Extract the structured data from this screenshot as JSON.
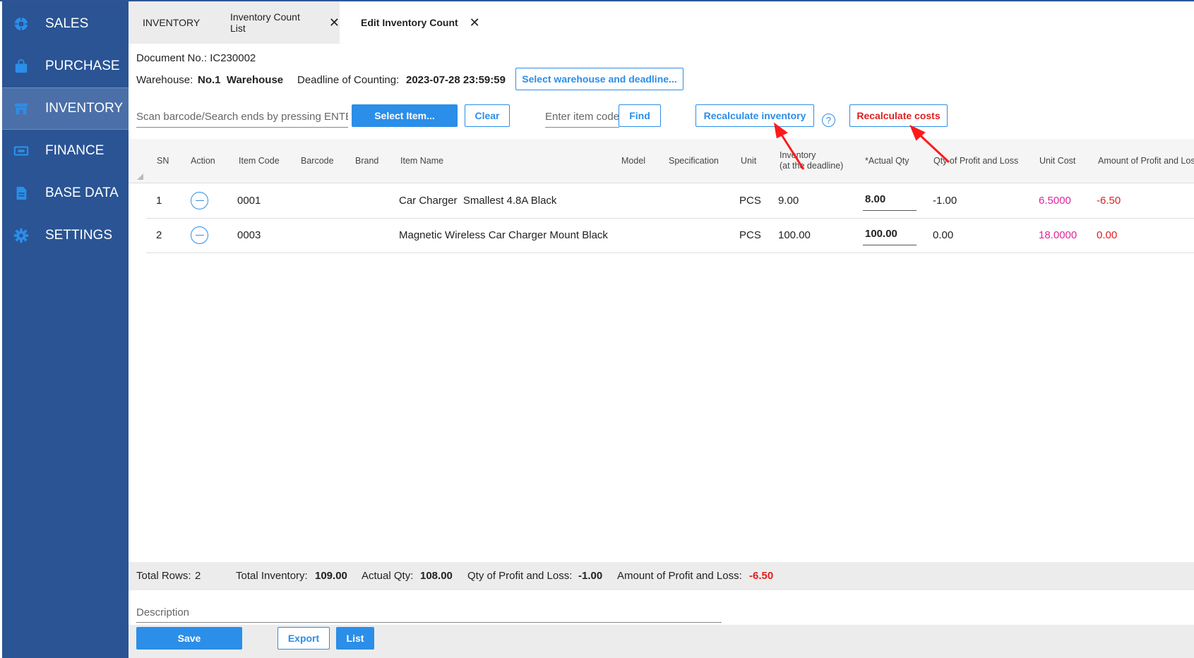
{
  "sidebar": {
    "items": [
      {
        "label": "SALES",
        "icon": "sales-gear-icon"
      },
      {
        "label": "PURCHASE",
        "icon": "shopping-bag-icon"
      },
      {
        "label": "INVENTORY",
        "icon": "store-icon",
        "active": true
      },
      {
        "label": "FINANCE",
        "icon": "money-icon"
      },
      {
        "label": "BASE DATA",
        "icon": "document-icon"
      },
      {
        "label": "SETTINGS",
        "icon": "gear-icon"
      }
    ]
  },
  "tabs": [
    {
      "label": "INVENTORY"
    },
    {
      "label": "Inventory Count List",
      "close": "✕"
    },
    {
      "label": "Edit Inventory Count",
      "close": "✕",
      "active": true
    }
  ],
  "header": {
    "document_label": "Document No.: IC230002",
    "warehouse_label": "Warehouse:",
    "warehouse_value": "No.1  Warehouse",
    "deadline_label": "Deadline of Counting:",
    "deadline_value": "2023-07-28 23:59:59",
    "select_warehouse_button": "Select warehouse and deadline..."
  },
  "toolbar": {
    "scan_placeholder": "Scan barcode/Search ends by pressing ENTER",
    "select_item_button": "Select Item...",
    "clear_button": "Clear",
    "item_code_placeholder": "Enter item code",
    "find_button": "Find",
    "recalc_inventory_button": "Recalculate inventory",
    "help_icon": "?",
    "recalc_costs_button": "Recalculate costs"
  },
  "table": {
    "columns": {
      "sn": "SN",
      "action": "Action",
      "item_code": "Item Code",
      "barcode": "Barcode",
      "brand": "Brand",
      "item_name": "Item Name",
      "model": "Model",
      "specification": "Specification",
      "unit": "Unit",
      "inventory_line1": "Inventory",
      "inventory_line2": "(at the deadline)",
      "actual_qty": "*Actual Qty",
      "qty_pl": "Qty of Profit and Loss",
      "unit_cost": "Unit Cost",
      "amount_pl": "Amount of Profit and Loss"
    },
    "rows": [
      {
        "sn": "1",
        "item_code": "0001",
        "item_name": "Car Charger  Smallest 4.8A Black",
        "unit": "PCS",
        "inventory": "9.00",
        "actual_qty": "8.00",
        "qty_pl": "-1.00",
        "unit_cost": "6.5000",
        "amount_pl": "-6.50"
      },
      {
        "sn": "2",
        "item_code": "0003",
        "item_name": "Magnetic Wireless Car Charger Mount Black",
        "unit": "PCS",
        "inventory": "100.00",
        "actual_qty": "100.00",
        "qty_pl": "0.00",
        "unit_cost": "18.0000",
        "amount_pl": "0.00"
      }
    ]
  },
  "summary": {
    "total_rows_label": "Total Rows:",
    "total_rows_value": "2",
    "total_inventory_label": "Total Inventory:",
    "total_inventory_value": "109.00",
    "actual_qty_label": "Actual Qty:",
    "actual_qty_value": "108.00",
    "qty_pl_label": "Qty of Profit and Loss:",
    "qty_pl_value": "-1.00",
    "amount_pl_label": "Amount of Profit and Loss:",
    "amount_pl_value": "-6.50"
  },
  "footer": {
    "description_placeholder": "Description",
    "save_button": "Save",
    "export_button": "Export",
    "list_button": "List"
  },
  "colors": {
    "sidebar": "#2a5494",
    "accent": "#2b8ee8",
    "negative": "#e02020",
    "cost": "#e0239a"
  }
}
